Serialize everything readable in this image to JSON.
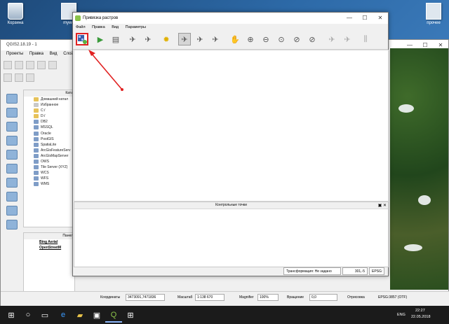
{
  "desktop": {
    "icons": [
      {
        "label": "Корзина"
      },
      {
        "label": "mywo"
      },
      {
        "label": "прочее"
      }
    ]
  },
  "qgis": {
    "title": "QGIS2.18.19 - 1",
    "menu": [
      "Проекты",
      "Правка",
      "Вид",
      "Слой"
    ],
    "browser_panel_title": "Катa",
    "browser_items": [
      {
        "label": "Домашний катал",
        "icon": "folder"
      },
      {
        "label": "Избранное",
        "icon": "star"
      },
      {
        "label": "C:/",
        "icon": "folder"
      },
      {
        "label": "D:/",
        "icon": "folder"
      },
      {
        "label": "DB2",
        "icon": "db"
      },
      {
        "label": "MSSQL",
        "icon": "db"
      },
      {
        "label": "Oracle",
        "icon": "db"
      },
      {
        "label": "PostGIS",
        "icon": "db"
      },
      {
        "label": "SpatiaLite",
        "icon": "db"
      },
      {
        "label": "ArcGisFeatureServ",
        "icon": "db"
      },
      {
        "label": "ArcGisMapServer",
        "icon": "db"
      },
      {
        "label": "OWS",
        "icon": "db"
      },
      {
        "label": "Tile Server (XYZ)",
        "icon": "db"
      },
      {
        "label": "WCS",
        "icon": "db"
      },
      {
        "label": "WFS",
        "icon": "db"
      },
      {
        "label": "WMS",
        "icon": "db"
      }
    ],
    "layers_panel_title": "Панел",
    "layers": [
      "Bing Aerial",
      "OpenStreetM"
    ],
    "status": {
      "coords_label": "Координаты",
      "coords_value": "3473091,7471836",
      "scale_label": "Масштаб",
      "scale_value": "1:138 670",
      "magnifier_label": "Magnifier",
      "magnifier_value": "100%",
      "rotation_label": "Вращение",
      "rotation_value": "0,0",
      "render_label": "Отрисовка",
      "crs_value": "EPSG:3857 (OTF)"
    }
  },
  "georeferencer": {
    "title": "Привязка растров",
    "menu": [
      "Файл",
      "Правка",
      "Вид",
      "Параметры"
    ],
    "controls": {
      "minimize": "—",
      "maximize": "☐",
      "close": "✕"
    },
    "gcp_panel_title": "Контрольные точки",
    "status": {
      "transform": "Трансформация: Не задано",
      "coords": "301,-5",
      "epsg": "EPSG:"
    }
  },
  "taskbar": {
    "lang": "ENG",
    "time": "22:27",
    "date": "22.05.2018"
  },
  "colors": {
    "highlight": "#e12222",
    "taskbar": "#1b1b1b"
  }
}
